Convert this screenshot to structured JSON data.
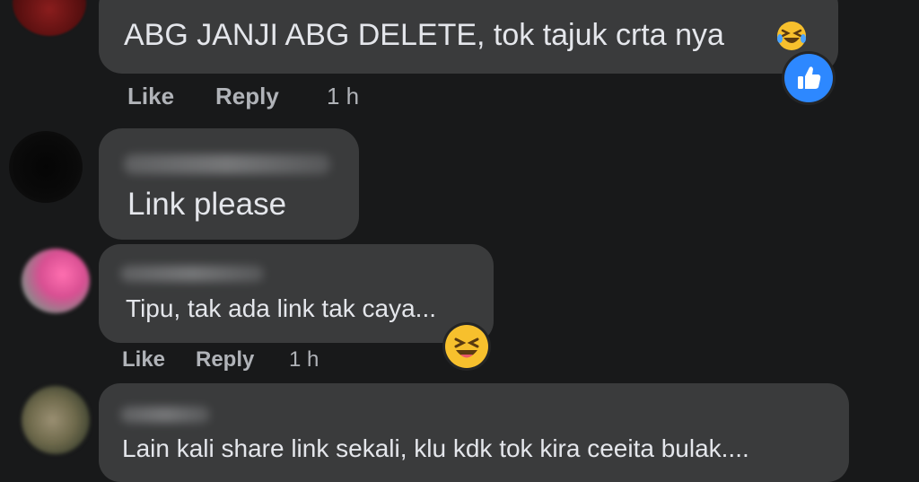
{
  "comments": [
    {
      "author": "",
      "text": "ABG JANJI ABG DELETE, tok tajuk crta nya",
      "inline_emoji": "laughing-tears-emoji",
      "reaction": "like-reaction",
      "actions": {
        "like": "Like",
        "reply": "Reply",
        "time": "1 h"
      }
    },
    {
      "author": "",
      "text": "Link please"
    },
    {
      "author": "",
      "text": "Tipu, tak ada link tak caya...",
      "reaction": "haha-reaction",
      "actions": {
        "like": "Like",
        "reply": "Reply",
        "time": "1 h"
      }
    },
    {
      "author": "",
      "text": "Lain kali share link sekali, klu kdk tok kira ceeita bulak...."
    }
  ],
  "colors": {
    "background": "#18191a",
    "bubble": "#3a3b3c",
    "text": "#e4e6eb",
    "secondary_text": "#b0b3b8",
    "like_blue": "#2d88ff",
    "haha_yellow": "#f7c02d"
  }
}
